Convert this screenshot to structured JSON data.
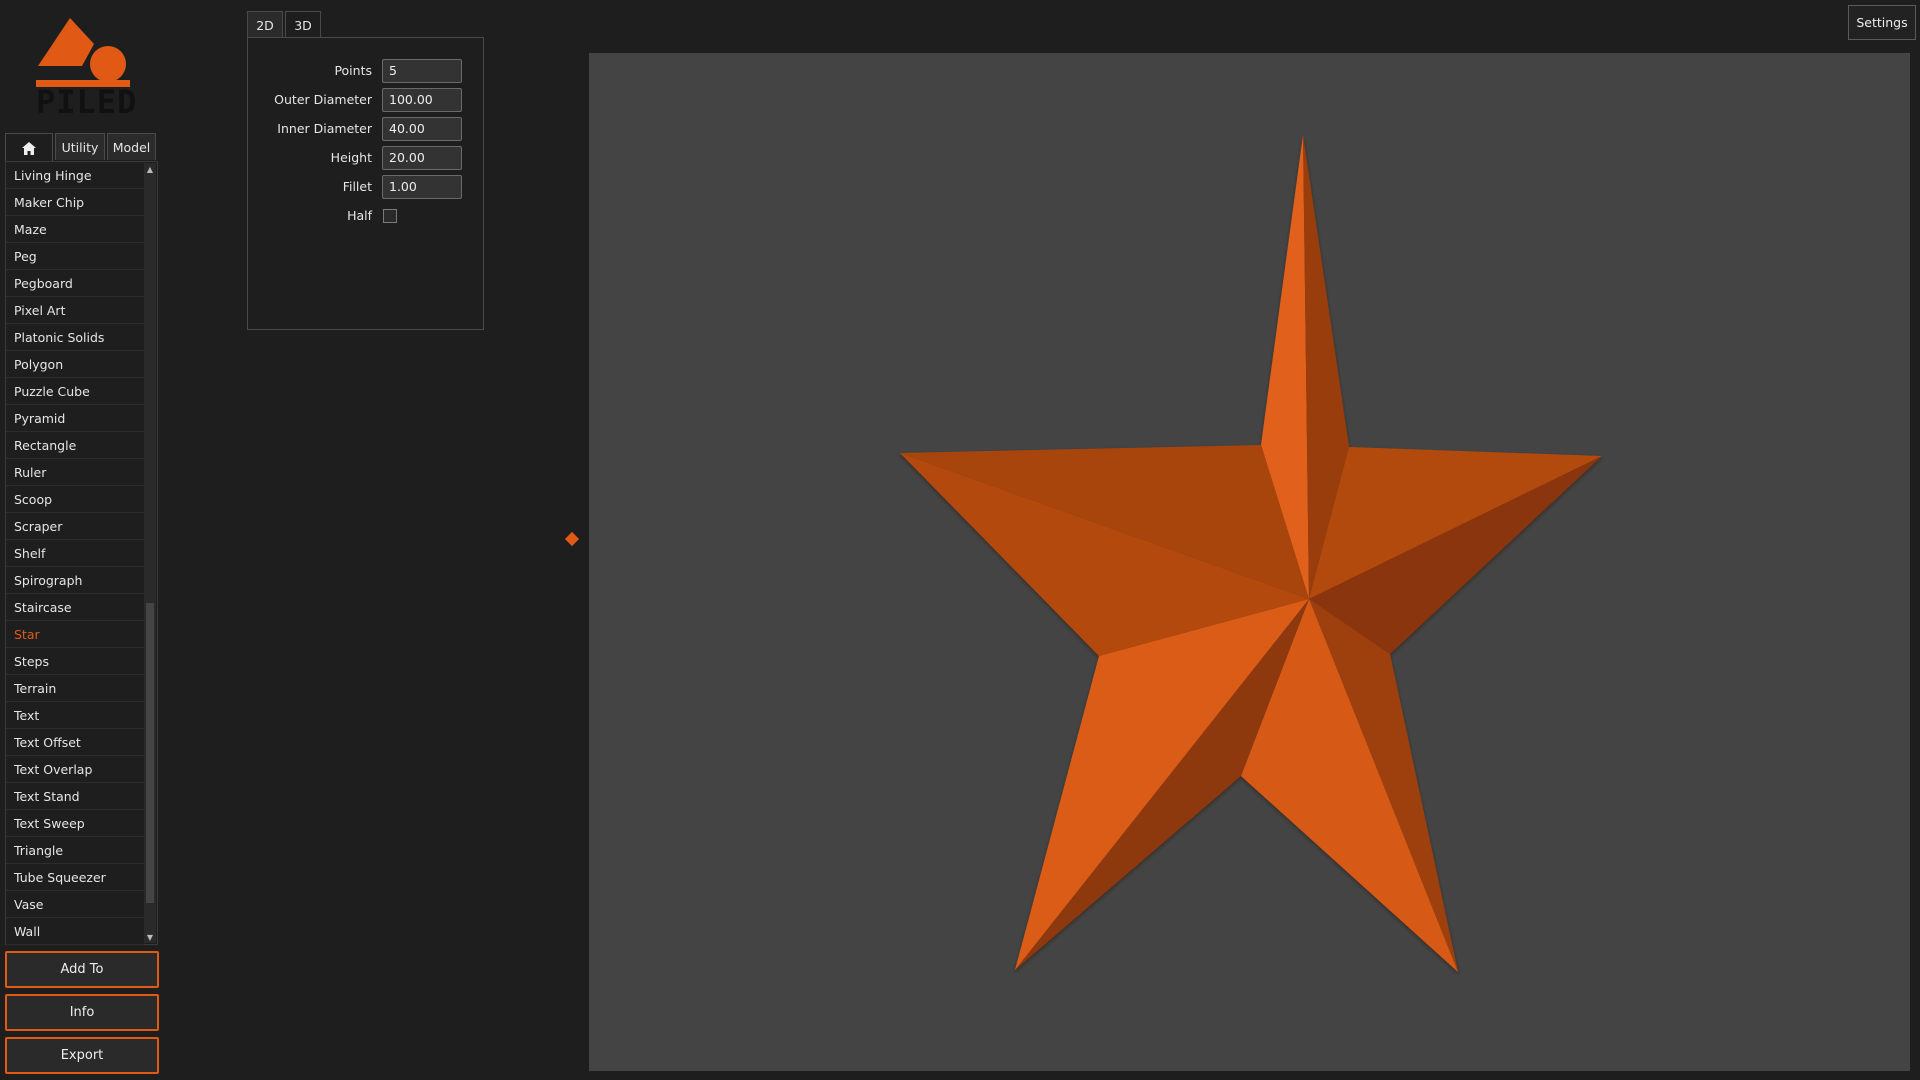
{
  "app": {
    "logo_text": "PILED",
    "accent_color": "#e05a16",
    "settings_label": "Settings"
  },
  "left_tabs": [
    {
      "icon": "home-icon",
      "label": ""
    },
    {
      "label": "Utility"
    },
    {
      "label": "Model"
    }
  ],
  "model_list": {
    "items": [
      "Living Hinge",
      "Maker Chip",
      "Maze",
      "Peg",
      "Pegboard",
      "Pixel Art",
      "Platonic Solids",
      "Polygon",
      "Puzzle Cube",
      "Pyramid",
      "Rectangle",
      "Ruler",
      "Scoop",
      "Scraper",
      "Shelf",
      "Spirograph",
      "Staircase",
      "Star",
      "Steps",
      "Terrain",
      "Text",
      "Text Offset",
      "Text Overlap",
      "Text Stand",
      "Text Sweep",
      "Triangle",
      "Tube Squeezer",
      "Vase",
      "Wall"
    ],
    "selected": "Star"
  },
  "actions": {
    "add_to": "Add To",
    "info": "Info",
    "export": "Export"
  },
  "param_tabs": [
    {
      "label": "2D"
    },
    {
      "label": "3D"
    }
  ],
  "params": [
    {
      "label": "Points",
      "value": "5"
    },
    {
      "label": "Outer Diameter",
      "value": "100.00"
    },
    {
      "label": "Inner Diameter",
      "value": "40.00"
    },
    {
      "label": "Height",
      "value": "20.00"
    },
    {
      "label": "Fillet",
      "value": "1.00"
    }
  ],
  "half": {
    "label": "Half",
    "checked": false
  },
  "viewport": {
    "background": "#444444",
    "model": "star"
  }
}
